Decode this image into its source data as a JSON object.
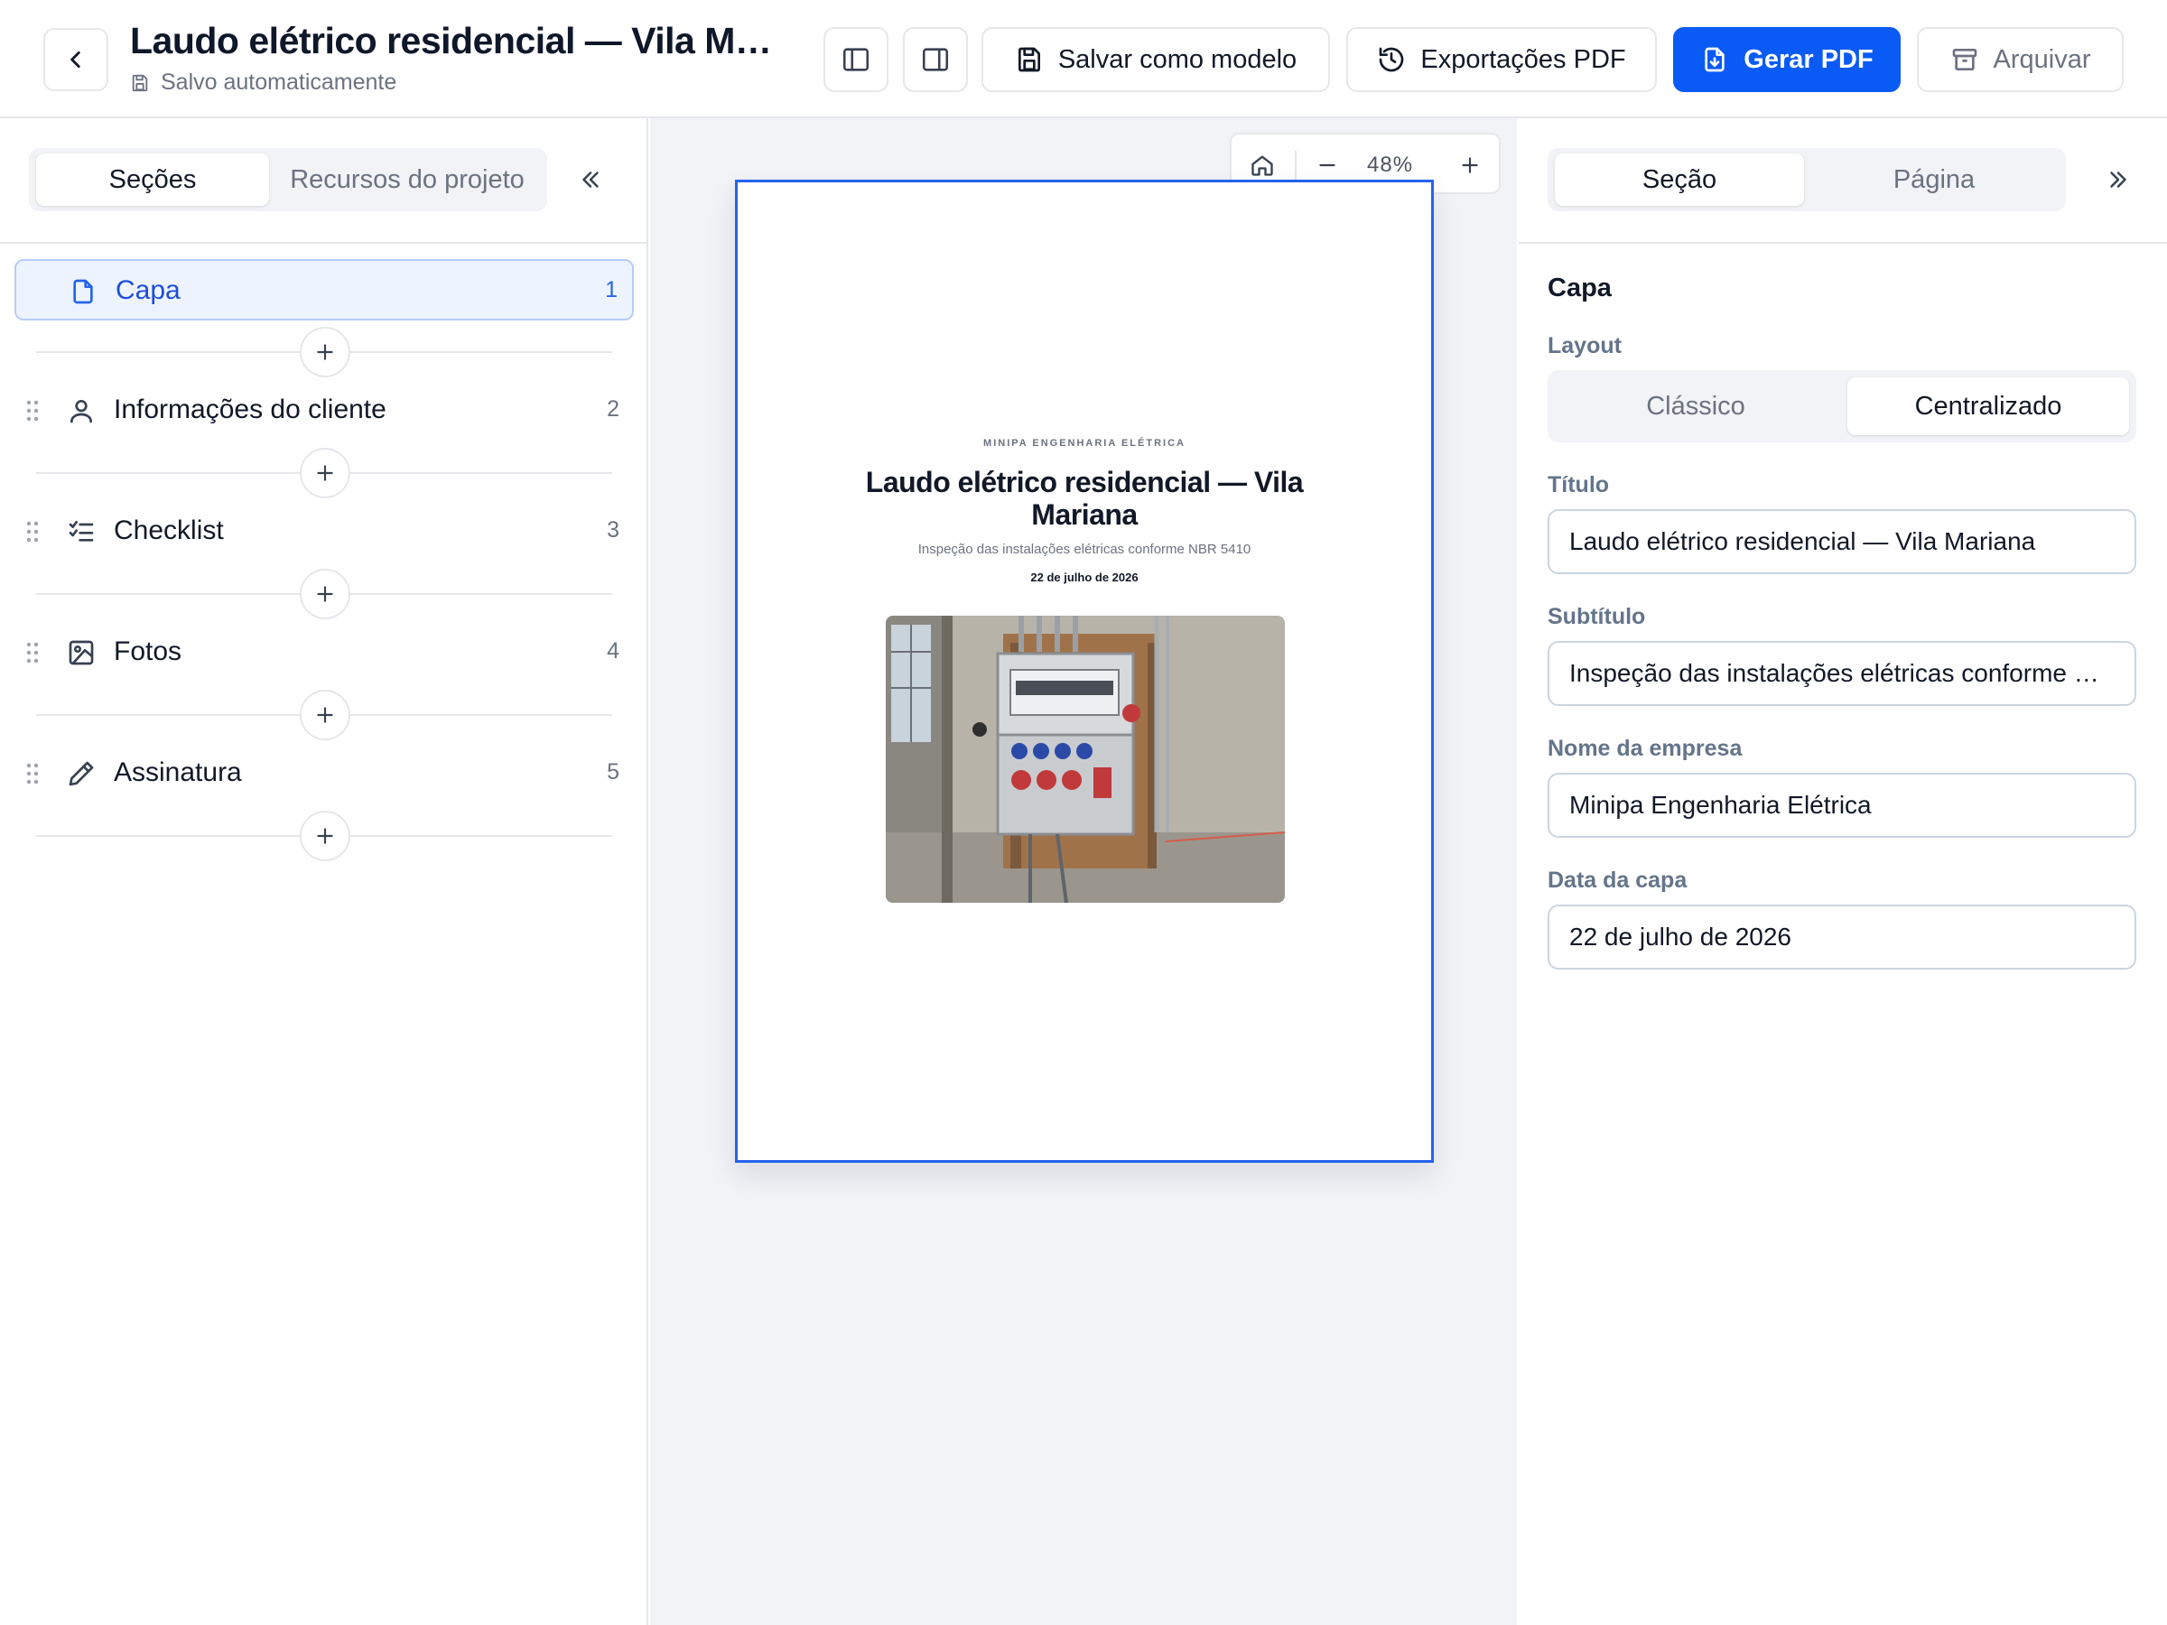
{
  "header": {
    "title": "Laudo elétrico residencial — Vila Ma…",
    "save_status": "Salvo automaticamente",
    "save_template_label": "Salvar como modelo",
    "exports_label": "Exportações PDF",
    "generate_label": "Gerar PDF",
    "archive_label": "Arquivar"
  },
  "left_panel": {
    "tabs": [
      {
        "label": "Seções",
        "active": true
      },
      {
        "label": "Recursos do projeto",
        "active": false
      }
    ],
    "sections": [
      {
        "label": "Capa",
        "number": "1",
        "icon": "file-icon",
        "active": true
      },
      {
        "label": "Informações do cliente",
        "number": "2",
        "icon": "user-icon",
        "active": false
      },
      {
        "label": "Checklist",
        "number": "3",
        "icon": "checklist-icon",
        "active": false
      },
      {
        "label": "Fotos",
        "number": "4",
        "icon": "image-icon",
        "active": false
      },
      {
        "label": "Assinatura",
        "number": "5",
        "icon": "pencil-icon",
        "active": false
      }
    ]
  },
  "canvas": {
    "zoom": "48%",
    "page": {
      "company": "MINIPA ENGENHARIA ELÉTRICA",
      "title": "Laudo elétrico residencial — Vila Mariana",
      "subtitle": "Inspeção das instalações elétricas conforme NBR 5410",
      "date": "22 de julho de 2026"
    }
  },
  "right_panel": {
    "tabs": [
      {
        "label": "Seção",
        "active": true
      },
      {
        "label": "Página",
        "active": false
      }
    ],
    "heading": "Capa",
    "layout_label": "Layout",
    "layout_options": [
      {
        "label": "Clássico",
        "active": false
      },
      {
        "label": "Centralizado",
        "active": true
      }
    ],
    "fields": {
      "title_label": "Título",
      "title_value": "Laudo elétrico residencial — Vila Mariana",
      "subtitle_label": "Subtítulo",
      "subtitle_value": "Inspeção das instalações elétricas conforme N…",
      "company_label": "Nome da empresa",
      "company_value": "Minipa Engenharia Elétrica",
      "date_label": "Data da capa",
      "date_value": "22 de julho de 2026"
    }
  },
  "colors": {
    "primary": "#0a5bf5",
    "active_bg": "#eef4ff",
    "canvas_bg": "#f1f3f7"
  }
}
